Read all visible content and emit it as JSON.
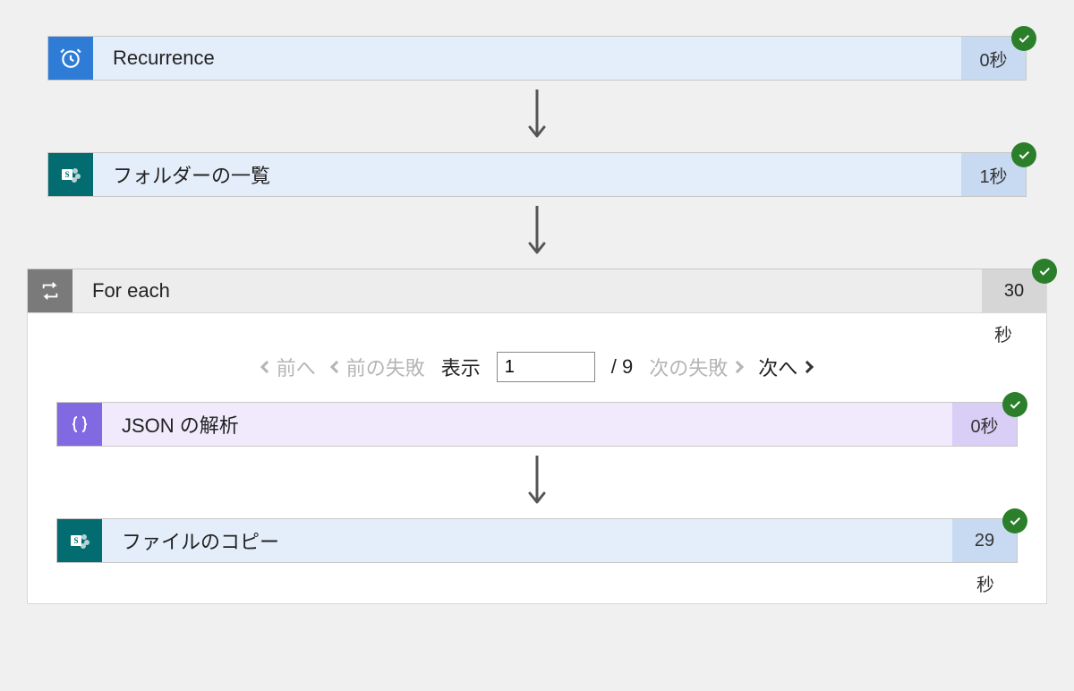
{
  "steps": {
    "recurrence": {
      "label": "Recurrence",
      "duration": "0秒"
    },
    "list_folder": {
      "label": "フォルダーの一覧",
      "duration": "1秒"
    },
    "for_each": {
      "label": "For each",
      "duration": "30",
      "unit": "秒"
    },
    "parse_json": {
      "label": "JSON の解析",
      "duration": "0秒"
    },
    "copy_file": {
      "label": "ファイルのコピー",
      "duration": "29",
      "unit": "秒"
    }
  },
  "pager": {
    "prev": "前へ",
    "prev_fail": "前の失敗",
    "show": "表示",
    "current": "1",
    "total": "/ 9",
    "next_fail": "次の失敗",
    "next": "次へ"
  }
}
